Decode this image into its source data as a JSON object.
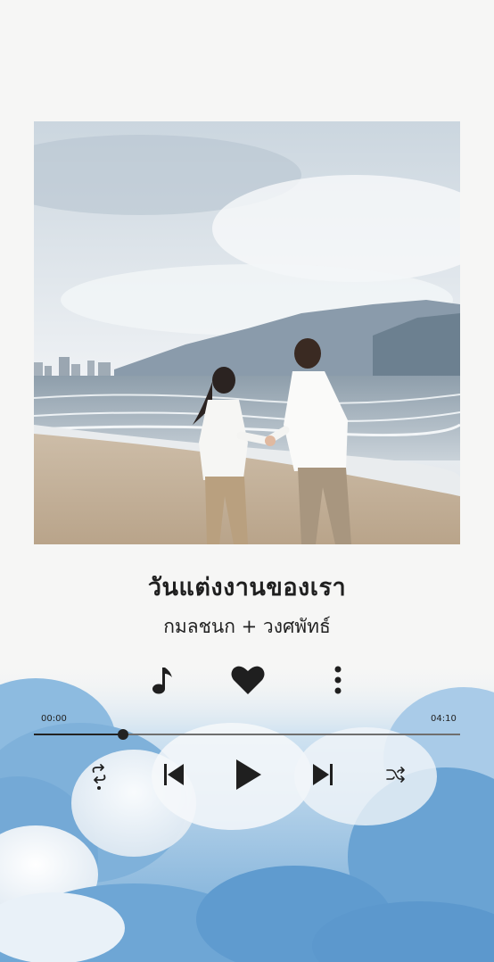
{
  "song": {
    "title": "วันแต่งงานของเรา",
    "artist": "กมลชนก + วงศพัทธ์"
  },
  "actions": {
    "music_icon": "music-note-icon",
    "like_icon": "heart-icon",
    "more_icon": "more-vertical-icon"
  },
  "player": {
    "current_time": "00:00",
    "total_time": "04:10",
    "progress": 0.21,
    "controls": [
      "repeat-icon",
      "previous-icon",
      "play-icon",
      "next-icon",
      "shuffle-icon"
    ]
  },
  "colors": {
    "background": "#f6f6f5",
    "text": "#1f1f1f",
    "sky": "#7fb0d8"
  }
}
